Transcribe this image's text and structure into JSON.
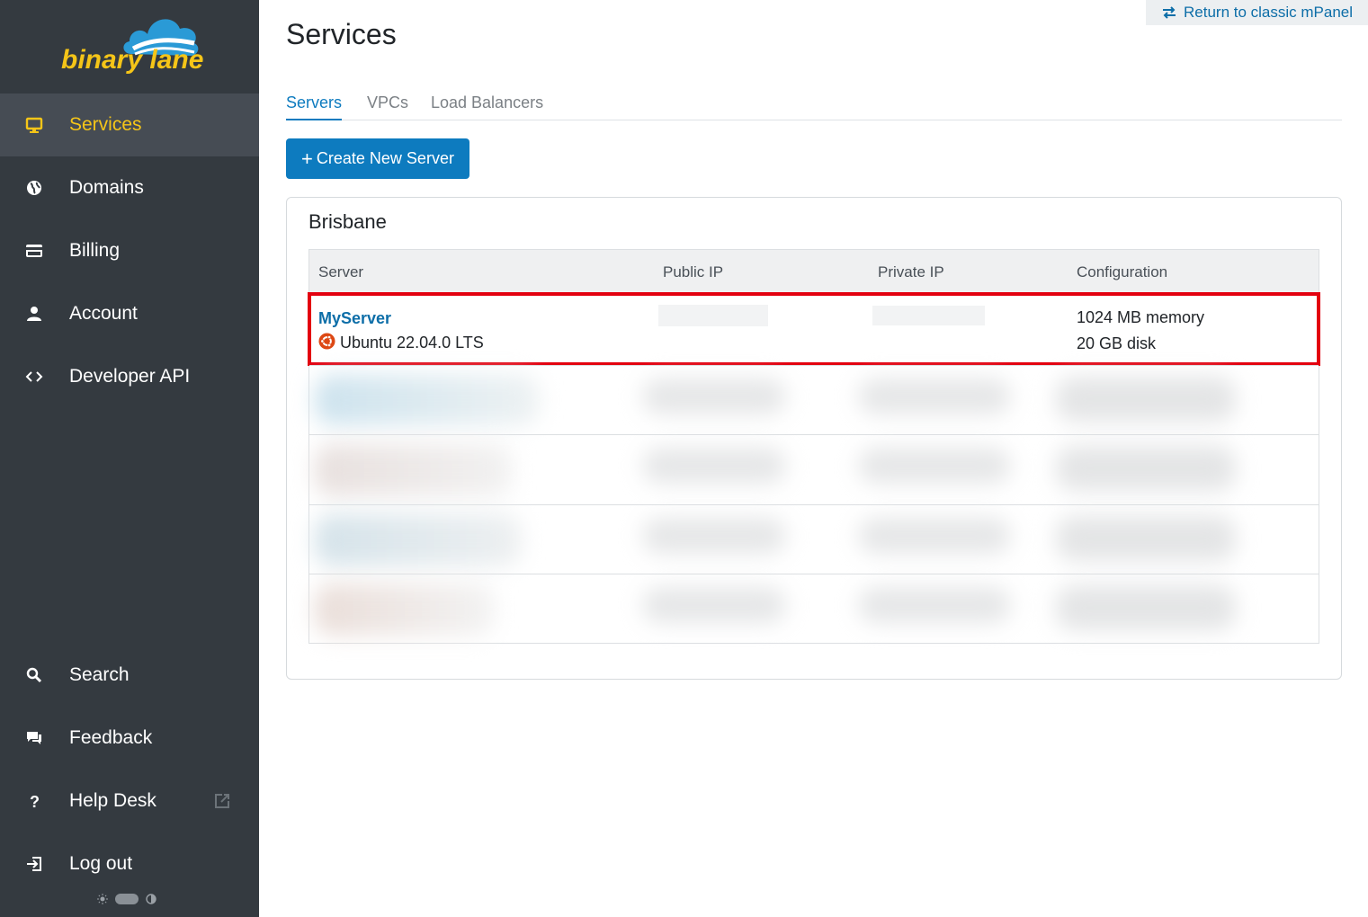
{
  "brand": {
    "logo_text": "binary lane"
  },
  "sidebar": {
    "items": [
      {
        "label": "Services",
        "icon": "monitor-icon"
      },
      {
        "label": "Domains",
        "icon": "globe-icon"
      },
      {
        "label": "Billing",
        "icon": "credit-card-icon"
      },
      {
        "label": "Account",
        "icon": "person-icon"
      },
      {
        "label": "Developer API",
        "icon": "code-icon"
      }
    ],
    "bottom_items": [
      {
        "label": "Search",
        "icon": "search-icon"
      },
      {
        "label": "Feedback",
        "icon": "chat-icon"
      },
      {
        "label": "Help Desk",
        "icon": "question-icon"
      },
      {
        "label": "Log out",
        "icon": "logout-icon"
      }
    ],
    "theme_toggle": {
      "light_icon": "sun-icon",
      "dark_icon": "contrast-icon"
    }
  },
  "header": {
    "classic_link": "Return to classic mPanel",
    "title": "Services"
  },
  "tabs": [
    {
      "label": "Servers",
      "active": true
    },
    {
      "label": "VPCs",
      "active": false
    },
    {
      "label": "Load Balancers",
      "active": false
    }
  ],
  "create_button": {
    "plus": "+",
    "label": "Create New Server"
  },
  "region": {
    "title": "Brisbane",
    "columns": [
      "Server",
      "Public IP",
      "Private IP",
      "Configuration"
    ],
    "server": {
      "name": "MyServer",
      "os": "Ubuntu 22.04.0 LTS",
      "memory": "1024 MB memory",
      "disk": "20 GB disk"
    }
  },
  "colors": {
    "sidebar_bg": "#343a40",
    "active_accent": "#f5c518",
    "primary": "#0d7bbf",
    "highlight_border": "#e3000f"
  }
}
